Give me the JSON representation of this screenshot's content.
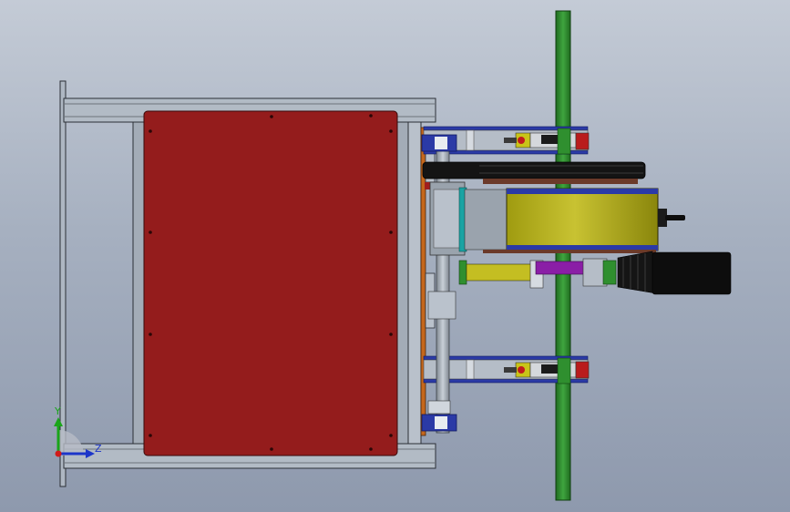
{
  "viewport": {
    "background_top": "#c4cbd6",
    "background_bottom": "#8e99ad"
  },
  "model": {
    "frame_color": "#aeb7c2",
    "panel_color": "#941c1c",
    "rail_color": "#2e8b2e",
    "motor_body_color": "#b5b020",
    "clamp_color": "#2b3aa6",
    "handle_color": "#0d0d0d"
  },
  "triad": {
    "y_label": "Y",
    "z_label": "Z",
    "y_color": "#1aa51a",
    "z_color": "#1c35c9",
    "x_color": "#d11a1a"
  }
}
